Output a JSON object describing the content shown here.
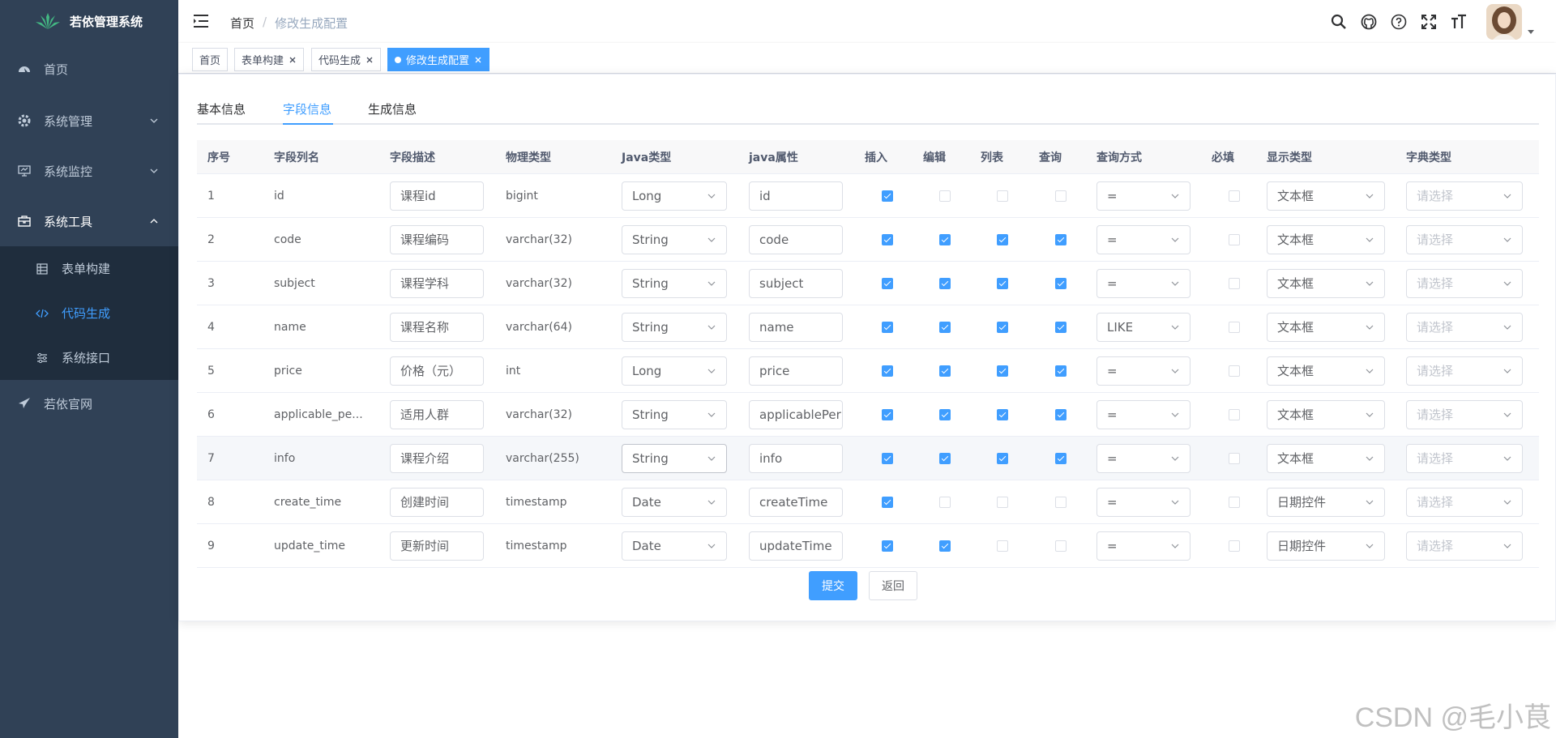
{
  "app": {
    "title": "若依管理系统"
  },
  "sidebar": {
    "items": [
      {
        "label": "首页"
      },
      {
        "label": "系统管理"
      },
      {
        "label": "系统监控"
      },
      {
        "label": "系统工具"
      }
    ],
    "subitems": [
      {
        "label": "表单构建"
      },
      {
        "label": "代码生成"
      },
      {
        "label": "系统接口"
      }
    ],
    "after": {
      "label": "若依官网"
    }
  },
  "breadcrumb": {
    "home": "首页",
    "sep": "/",
    "current": "修改生成配置"
  },
  "tags": [
    {
      "label": "首页"
    },
    {
      "label": "表单构建"
    },
    {
      "label": "代码生成"
    },
    {
      "label": "修改生成配置"
    }
  ],
  "tabs": [
    {
      "label": "基本信息"
    },
    {
      "label": "字段信息"
    },
    {
      "label": "生成信息"
    }
  ],
  "table": {
    "headers": [
      "序号",
      "字段列名",
      "字段描述",
      "物理类型",
      "Java类型",
      "java属性",
      "插入",
      "编辑",
      "列表",
      "查询",
      "查询方式",
      "必填",
      "显示类型",
      "字典类型"
    ],
    "rows": [
      {
        "no": "1",
        "col": "id",
        "desc": "课程id",
        "phys": "bigint",
        "jtype": "Long",
        "jprop": "id",
        "ins": true,
        "edit": false,
        "list": false,
        "query": false,
        "qtype": "=",
        "req": false,
        "html": "文本框",
        "dict": "请选择"
      },
      {
        "no": "2",
        "col": "code",
        "desc": "课程编码",
        "phys": "varchar(32)",
        "jtype": "String",
        "jprop": "code",
        "ins": true,
        "edit": true,
        "list": true,
        "query": true,
        "qtype": "=",
        "req": false,
        "html": "文本框",
        "dict": "请选择"
      },
      {
        "no": "3",
        "col": "subject",
        "desc": "课程学科",
        "phys": "varchar(32)",
        "jtype": "String",
        "jprop": "subject",
        "ins": true,
        "edit": true,
        "list": true,
        "query": true,
        "qtype": "=",
        "req": false,
        "html": "文本框",
        "dict": "请选择"
      },
      {
        "no": "4",
        "col": "name",
        "desc": "课程名称",
        "phys": "varchar(64)",
        "jtype": "String",
        "jprop": "name",
        "ins": true,
        "edit": true,
        "list": true,
        "query": true,
        "qtype": "LIKE",
        "req": false,
        "html": "文本框",
        "dict": "请选择"
      },
      {
        "no": "5",
        "col": "price",
        "desc": "价格（元）",
        "phys": "int",
        "jtype": "Long",
        "jprop": "price",
        "ins": true,
        "edit": true,
        "list": true,
        "query": true,
        "qtype": "=",
        "req": false,
        "html": "文本框",
        "dict": "请选择"
      },
      {
        "no": "6",
        "col": "applicable_pe...",
        "desc": "适用人群",
        "phys": "varchar(32)",
        "jtype": "String",
        "jprop": "applicablePer",
        "ins": true,
        "edit": true,
        "list": true,
        "query": true,
        "qtype": "=",
        "req": false,
        "html": "文本框",
        "dict": "请选择"
      },
      {
        "no": "7",
        "col": "info",
        "desc": "课程介绍",
        "phys": "varchar(255)",
        "jtype": "String",
        "jprop": "info",
        "ins": true,
        "edit": true,
        "list": true,
        "query": true,
        "qtype": "=",
        "req": false,
        "html": "文本框",
        "dict": "请选择"
      },
      {
        "no": "8",
        "col": "create_time",
        "desc": "创建时间",
        "phys": "timestamp",
        "jtype": "Date",
        "jprop": "createTime",
        "ins": true,
        "edit": false,
        "list": false,
        "query": false,
        "qtype": "=",
        "req": false,
        "html": "日期控件",
        "dict": "请选择"
      },
      {
        "no": "9",
        "col": "update_time",
        "desc": "更新时间",
        "phys": "timestamp",
        "jtype": "Date",
        "jprop": "updateTime",
        "ins": true,
        "edit": true,
        "list": false,
        "query": false,
        "qtype": "=",
        "req": false,
        "html": "日期控件",
        "dict": "请选择"
      }
    ]
  },
  "buttons": {
    "submit": "提交",
    "back": "返回"
  },
  "watermark": "CSDN @毛小茛",
  "colors": {
    "sidebar_bg": "#304156",
    "submenu_bg": "#1f2d3d",
    "accent": "#409eff"
  }
}
